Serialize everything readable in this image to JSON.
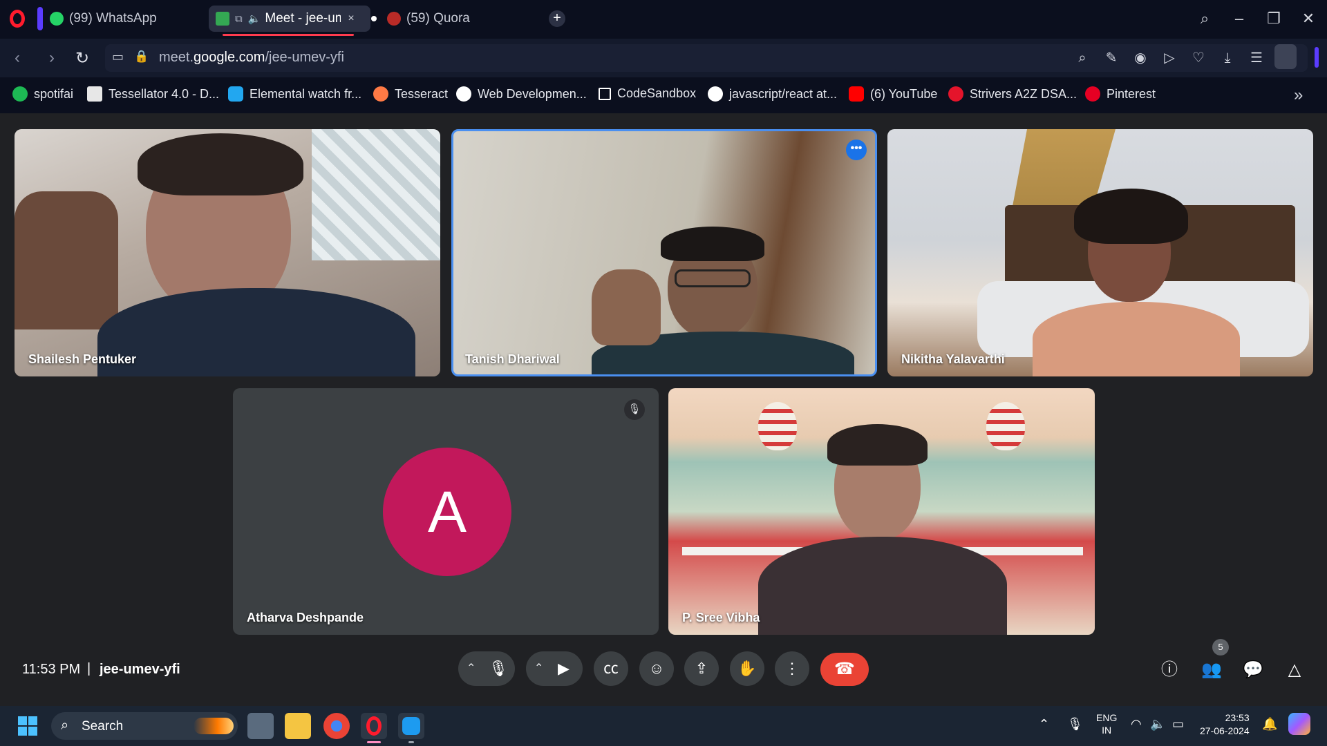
{
  "browser": {
    "tabs": [
      {
        "label": "(99) WhatsApp",
        "active": false
      },
      {
        "label": "Meet - jee-um",
        "active": true
      },
      {
        "label": "(59) Quora",
        "active": false
      }
    ],
    "tab_close_symbol": "×",
    "new_tab_symbol": "+",
    "url_prefix": "meet.",
    "url_domain": "google.com",
    "url_path": "/jee-umev-yfi",
    "bookmarks": [
      {
        "label": "spotifai",
        "icon": "spotify-icon",
        "color": "#1db954"
      },
      {
        "label": "Tessellator 4.0 - D...",
        "icon": "tessellator-icon",
        "color": "#ffffff"
      },
      {
        "label": "Elemental watch fr...",
        "icon": "skype-icon",
        "color": "#22a7f0"
      },
      {
        "label": "Tesseract",
        "icon": "tesseract-icon",
        "color": "#ff7a45"
      },
      {
        "label": "Web Developmen...",
        "icon": "web-dev-icon",
        "color": "#ffffff"
      },
      {
        "label": "CodeSandbox",
        "icon": "codesandbox-icon",
        "color": "#ffffff"
      },
      {
        "label": "javascript/react at...",
        "icon": "github-icon",
        "color": "#ffffff"
      },
      {
        "label": "(6) YouTube",
        "icon": "youtube-icon",
        "color": "#ff0000"
      },
      {
        "label": "Strivers A2Z DSA...",
        "icon": "tuf-icon",
        "color": "#e5142b"
      },
      {
        "label": "Pinterest",
        "icon": "pinterest-icon",
        "color": "#e60023"
      }
    ]
  },
  "meet": {
    "participants": [
      {
        "name": "Shailesh Pentuker"
      },
      {
        "name": "Tanish Dhariwal"
      },
      {
        "name": "Nikitha Yalavarthi"
      },
      {
        "name": "Atharva Deshpande",
        "avatar_letter": "A"
      },
      {
        "name": "P. Sree Vibha"
      }
    ],
    "time": "11:53 PM",
    "separator": "|",
    "meeting_code": "jee-umev-yfi",
    "participant_count": "5",
    "colors": {
      "avatar": "#c2185b",
      "end_call": "#ea4335",
      "active_speaker": "#4a8ff0"
    }
  },
  "taskbar": {
    "search_label": "Search",
    "language_top": "ENG",
    "language_bottom": "IN",
    "clock_time": "23:53",
    "clock_date": "27-06-2024"
  }
}
